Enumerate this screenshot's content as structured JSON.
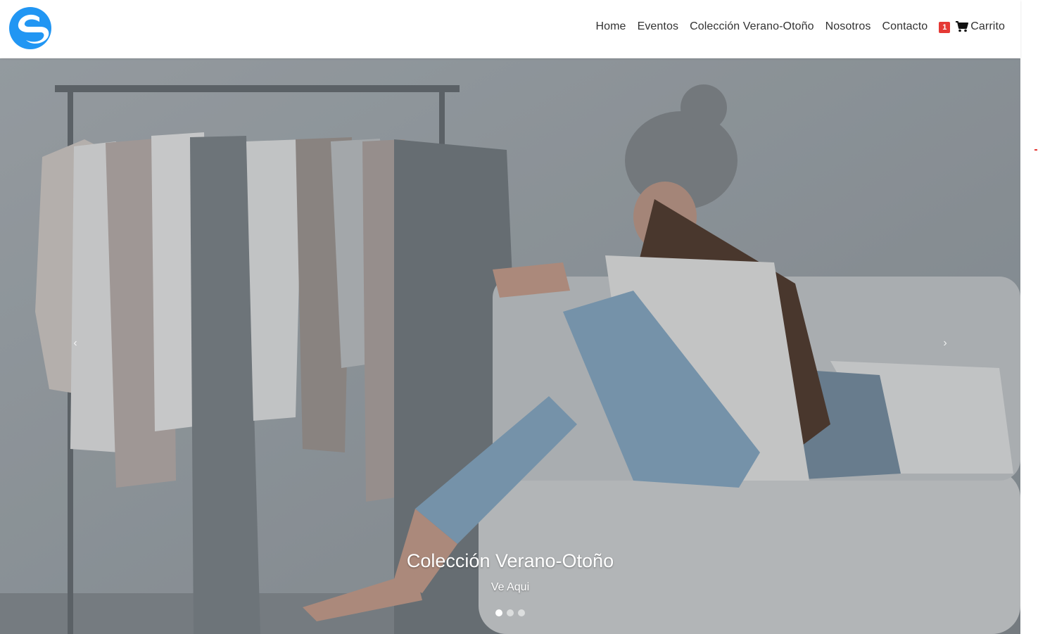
{
  "brand": {
    "logo_icon": "brand-s-logo-icon",
    "logo_color": "#2196f3"
  },
  "nav": {
    "links": [
      "Home",
      "Eventos",
      "Colección Verano-Otoño",
      "Nosotros",
      "Contacto"
    ],
    "cart": {
      "badge_count": "1",
      "icon": "shopping-cart-icon",
      "label": "Carrito",
      "badge_color": "#e53935"
    }
  },
  "carousel": {
    "caption_title": "Colección Verano-Otoño",
    "caption_link": "Ve Aqui",
    "slide_count": 3,
    "active_slide": 1,
    "prev_icon": "chevron-left-icon",
    "next_icon": "chevron-right-icon"
  }
}
